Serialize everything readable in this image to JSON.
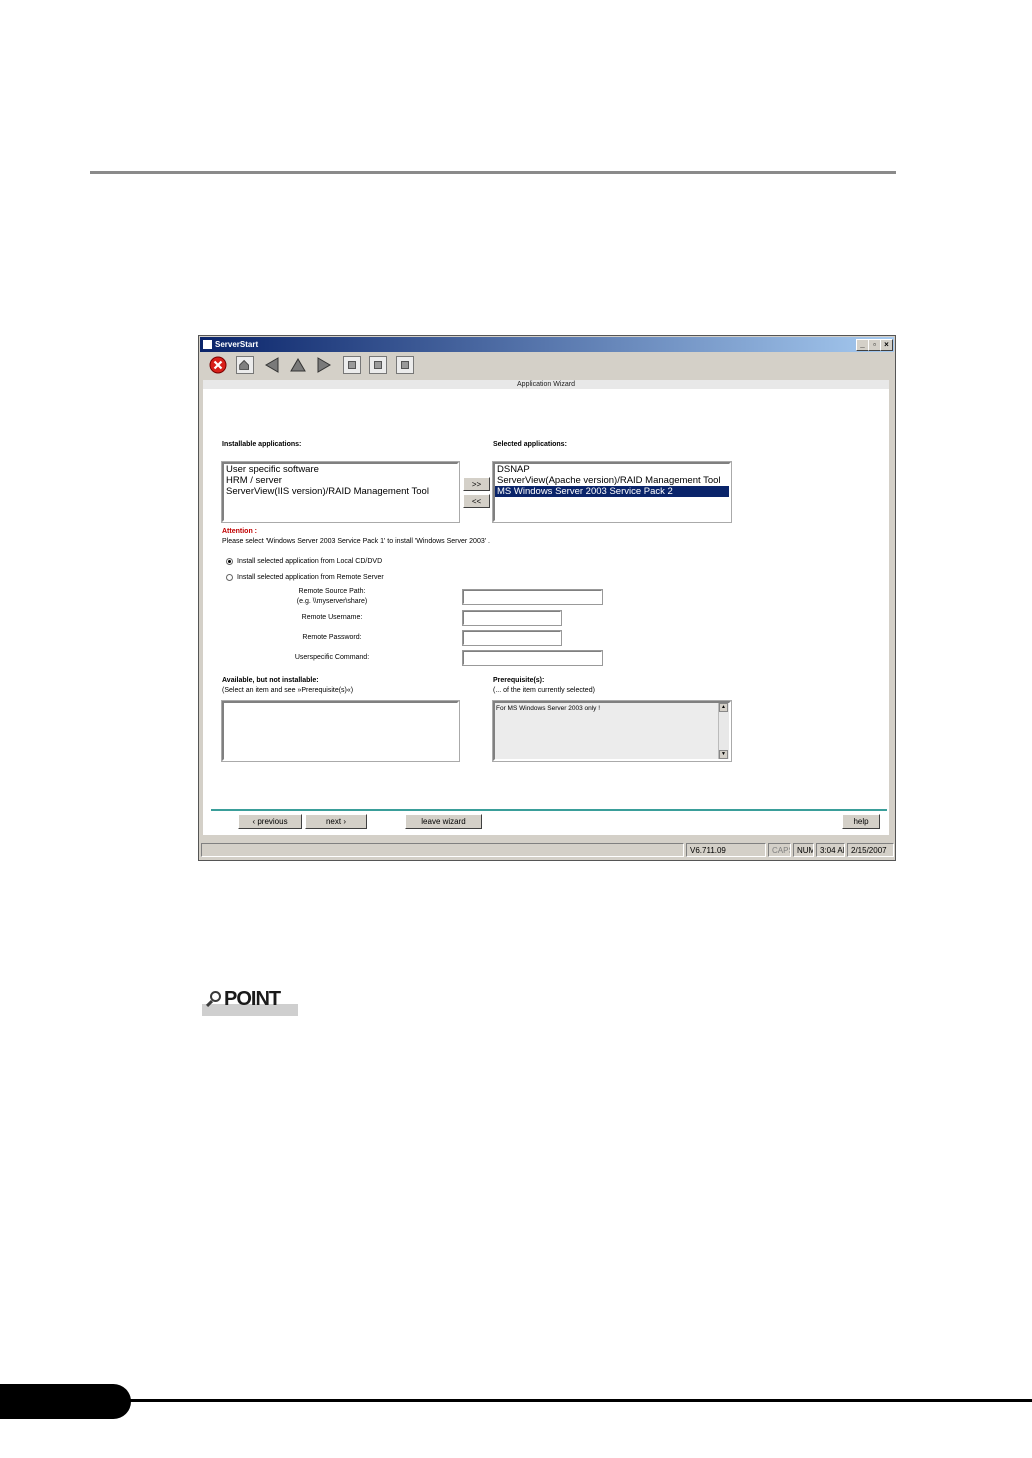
{
  "window": {
    "title": "ServerStart",
    "controls": {
      "minimize": "_",
      "restore": "▫",
      "close": "×"
    }
  },
  "toolbar": {
    "icons": [
      "stop-icon",
      "home-icon",
      "back-icon",
      "up-icon",
      "forward-icon",
      "window-icon",
      "print-icon",
      "grid-icon"
    ]
  },
  "wizard": {
    "header": "Application Wizard",
    "installable_label": "Installable applications:",
    "installable_items": [
      "User specific software",
      "HRM / server",
      "ServerView(IIS version)/RAID Management Tool"
    ],
    "selected_label": "Selected applications:",
    "selected_items": [
      "DSNAP",
      "ServerView(Apache version)/RAID Management Tool",
      "MS Windows Server 2003 Service Pack 2"
    ],
    "selected_index": 2,
    "add_button": ">>",
    "remove_button": "<<",
    "attention_title": "Attention :",
    "attention_text": "Please select 'Windows Server 2003 Service Pack 1' to install 'Windows Server 2003' .",
    "radio_local": "Install selected application from Local CD/DVD",
    "radio_remote": "Install selected application from Remote Server",
    "remote_source_label": "Remote Source Path:",
    "remote_source_hint": "(e.g. \\\\myserver\\share)",
    "remote_username_label": "Remote Username:",
    "remote_password_label": "Remote Password:",
    "userspecific_label": "Userspecific Command:",
    "unavailable_label": "Available, but not installable:",
    "unavailable_hint": "(Select an item and see »Prerequisite(s)«)",
    "prereq_label": "Prerequisite(s):",
    "prereq_hint": "(... of the item currently selected)",
    "prereq_text": "For MS Windows Server 2003 only !"
  },
  "buttons": {
    "previous": "‹ previous",
    "next": "next ›",
    "leave": "leave wizard",
    "help": "help"
  },
  "status": {
    "version": "V6.711.09",
    "caps": "CAPS",
    "num": "NUM",
    "time": "3:04 AM",
    "date": "2/15/2007"
  },
  "point_label": "POINT"
}
